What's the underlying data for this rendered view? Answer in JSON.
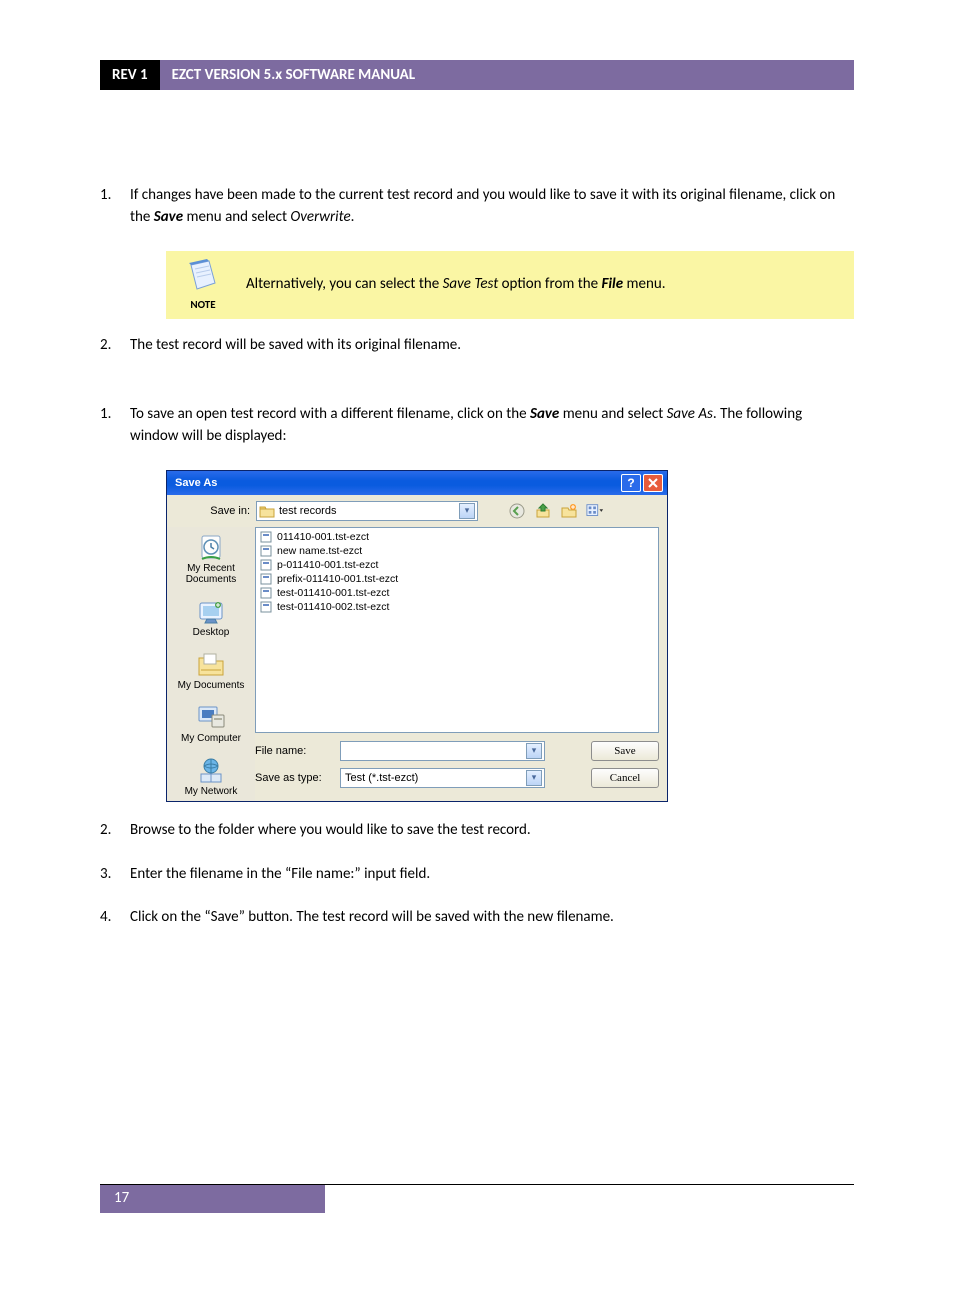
{
  "header": {
    "rev": "REV 1",
    "title": "EZCT VERSION 5.x SOFTWARE MANUAL"
  },
  "list1": {
    "n1": "1.",
    "item1_pre": "If changes have been made to the current test record and you would like to save it with its original filename, click on the ",
    "item1_save": "Save",
    "item1_mid": " menu and select ",
    "item1_overwrite": "Overwrite",
    "item1_post": ".",
    "note_label": "NOTE",
    "note_pre": "Alternatively, you can select the ",
    "note_save_test": "Save Test",
    "note_mid": " option from the ",
    "note_file": "File",
    "note_post": " menu.",
    "n2": "2.",
    "item2": "The test record will be saved with its original filename."
  },
  "list2": {
    "n1": "1.",
    "item1_pre": "To save an open test record with a different filename, click on the ",
    "item1_save": "Save",
    "item1_mid": " menu and select ",
    "item1_saveas": "Save As",
    "item1_post": ". The following window will be displayed:",
    "n2": "2.",
    "item2": "Browse to the folder where you would like to save the test record.",
    "n3": "3.",
    "item3": "Enter the filename in the “File name:” input field.",
    "n4": "4.",
    "item4": "Click on the “Save” button. The test record will be saved with the new filename."
  },
  "dialog": {
    "title": "Save As",
    "save_in_label": "Save in:",
    "save_in_value": "test records",
    "places": {
      "recent": "My Recent Documents",
      "desktop": "Desktop",
      "mydocs": "My Documents",
      "mycomp": "My Computer",
      "mynet": "My Network"
    },
    "files": [
      "011410-001.tst-ezct",
      "new name.tst-ezct",
      "p-011410-001.tst-ezct",
      "prefix-011410-001.tst-ezct",
      "test-011410-001.tst-ezct",
      "test-011410-002.tst-ezct"
    ],
    "file_name_label": "File name:",
    "file_name_value": "",
    "save_type_label": "Save as type:",
    "save_type_value": "Test (*.tst-ezct)",
    "save_btn": "Save",
    "cancel_btn": "Cancel"
  },
  "footer": {
    "page": "17"
  }
}
